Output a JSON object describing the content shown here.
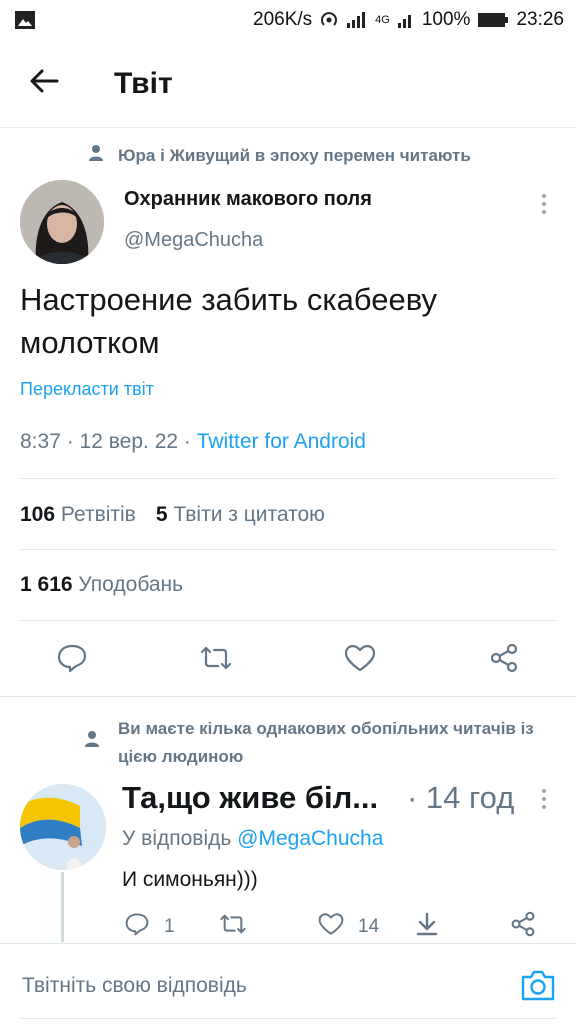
{
  "status_bar": {
    "speed": "206K/s",
    "network": "4G",
    "battery": "100%",
    "time": "23:26"
  },
  "header": {
    "title": "Твіт"
  },
  "main_tweet": {
    "social_context": "Юра і Живущий в эпоху перемен читають",
    "author_name": "Охранник макового поля",
    "author_handle": "@MegaChucha",
    "text_line1": "Настроение забить скабееву",
    "text_line2": "молотком",
    "translate_label": "Перекласти твіт",
    "time": "8:37",
    "date": "12 вер. 22",
    "source": "Twitter for Android",
    "retweets_count": "106",
    "retweets_label": "Ретвітів",
    "quotes_count": "5",
    "quotes_label": "Твіти з цитатою",
    "likes_count": "1 616",
    "likes_label": "Уподобань"
  },
  "reply": {
    "mutual_context": "Ви маєте кілька однакових обопільних читачів із цією людиною",
    "author_name": "Та,що живе біл...",
    "time": "· 14 год",
    "replying_to_prefix": "У відповідь",
    "replying_to_handle": "@MegaChucha",
    "text": "И симоньян)))",
    "reply_count": "1",
    "likes_count": "14"
  },
  "composer": {
    "placeholder": "Твітніть свою відповідь"
  },
  "colors": {
    "accent": "#1da1f2",
    "secondary_text": "#657786",
    "divider": "#e1e8ed"
  },
  "icons": [
    "image-icon",
    "hotspot-icon",
    "signal-icon",
    "battery-icon",
    "back-arrow-icon",
    "person-icon",
    "more-vertical-icon",
    "reply-icon",
    "retweet-icon",
    "like-icon",
    "share-icon",
    "camera-icon"
  ]
}
